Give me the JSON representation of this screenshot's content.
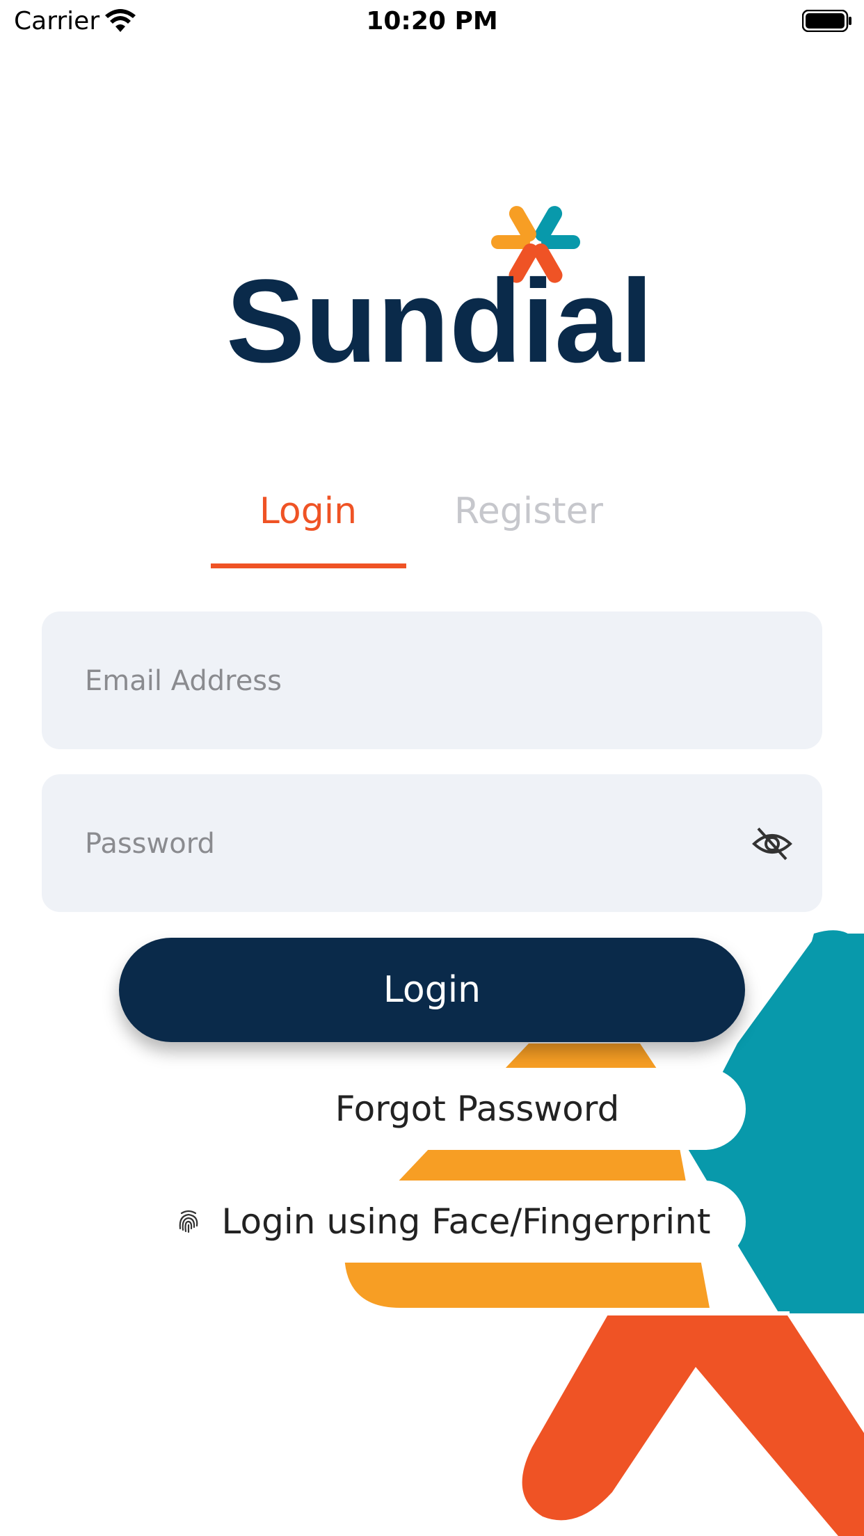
{
  "status_bar": {
    "carrier": "Carrier",
    "time": "10:20 PM"
  },
  "brand": {
    "name": "Sundial",
    "colors": {
      "navy": "#0a2a4a",
      "orange_red": "#ef5325",
      "orange": "#f79e24",
      "teal": "#0899ab"
    }
  },
  "tabs": [
    {
      "label": "Login",
      "active": true
    },
    {
      "label": "Register",
      "active": false
    }
  ],
  "form": {
    "email_placeholder": "Email Address",
    "email_value": "",
    "password_placeholder": "Password",
    "password_value": "",
    "submit_label": "Login"
  },
  "links": {
    "forgot_password": "Forgot Password",
    "biometric_login": "Login using Face/Fingerprint"
  },
  "icons": [
    "wifi-icon",
    "battery-icon",
    "eye-slash-icon",
    "fingerprint-icon"
  ]
}
